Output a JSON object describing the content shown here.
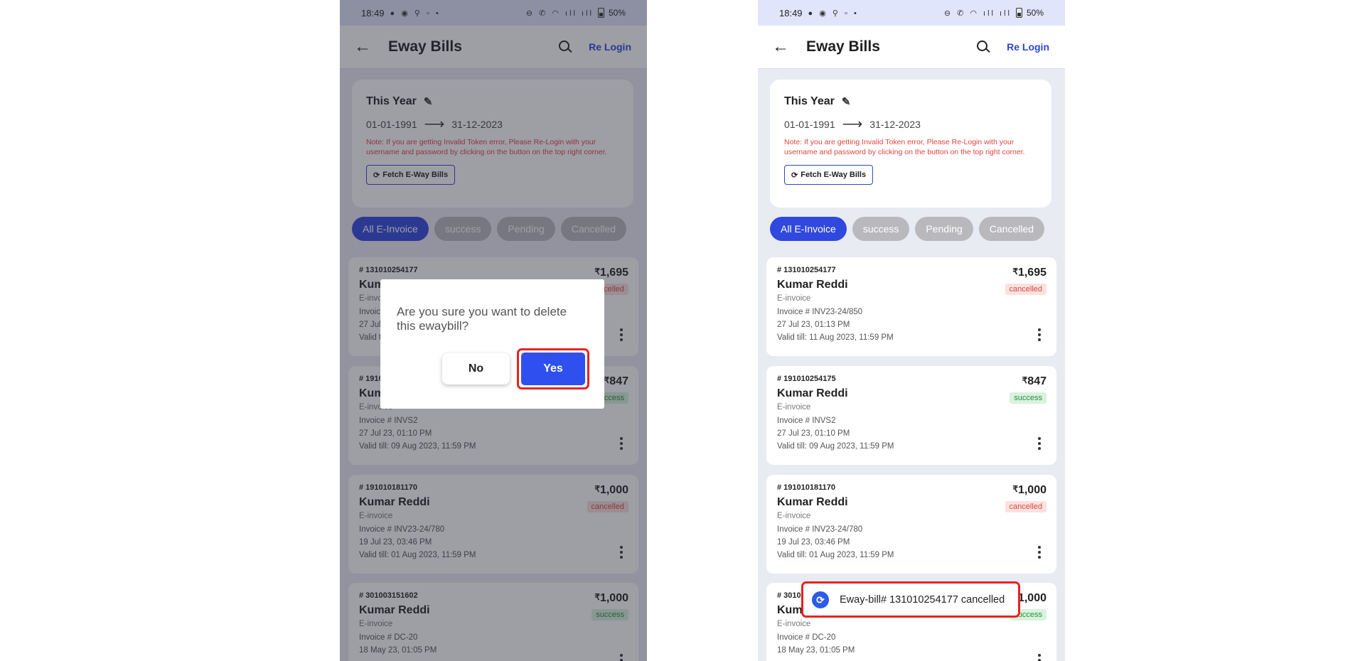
{
  "status_bar": {
    "time": "18:49",
    "left_icons": "● ◉ ⚲ ▫ •",
    "right_icons": "⊖ ✆ ◠ ıll ıll",
    "battery": "50%"
  },
  "header": {
    "back_icon": "←",
    "title": "Eway Bills",
    "relogin": "Re Login"
  },
  "filter_card": {
    "period": "This Year",
    "pencil_icon": "✎",
    "date_from": "01-01-1991",
    "arrow": "⟶",
    "date_to": "31-12-2023",
    "note": "Note: If you are getting Invalid Token error, Please Re-Login with your username and password by clicking on the button on the top right corner.",
    "fetch_icon": "⟳",
    "fetch_label": "Fetch E-Way Bills"
  },
  "chips": [
    "All E-Invoice",
    "success",
    "Pending",
    "Cancelled"
  ],
  "currency": "₹",
  "bills": [
    {
      "number": "# 131010254177",
      "name": "Kumar Reddi",
      "type": "E-invoice",
      "invoice": "Invoice # INV23-24/850",
      "datetime": "27 Jul 23, 01:13 PM",
      "valid": "Valid till: 11 Aug 2023, 11:59 PM",
      "amount": "1,695",
      "status": "cancelled"
    },
    {
      "number": "# 191010254175",
      "name": "Kumar Reddi",
      "type": "E-invoice",
      "invoice": "Invoice # INVS2",
      "datetime": "27 Jul 23, 01:10 PM",
      "valid": "Valid till: 09 Aug 2023, 11:59 PM",
      "amount": "847",
      "status": "success"
    },
    {
      "number": "# 191010181170",
      "name": "Kumar Reddi",
      "type": "E-invoice",
      "invoice": "Invoice # INV23-24/780",
      "datetime": "19 Jul 23, 03:46 PM",
      "valid": "Valid till: 01 Aug 2023, 11:59 PM",
      "amount": "1,000",
      "status": "cancelled"
    },
    {
      "number": "# 301003151602",
      "name": "Kumar Reddi",
      "type": "E-invoice",
      "invoice": "Invoice # DC-20",
      "datetime": "18 May 23, 01:05 PM",
      "valid": "",
      "amount": "1,000",
      "status": "success"
    }
  ],
  "dialog": {
    "message": "Are you sure you want to delete this ewaybill?",
    "no": "No",
    "yes": "Yes"
  },
  "toast": {
    "icon": "⟳",
    "message": "Eway-bill# 131010254177 cancelled"
  }
}
